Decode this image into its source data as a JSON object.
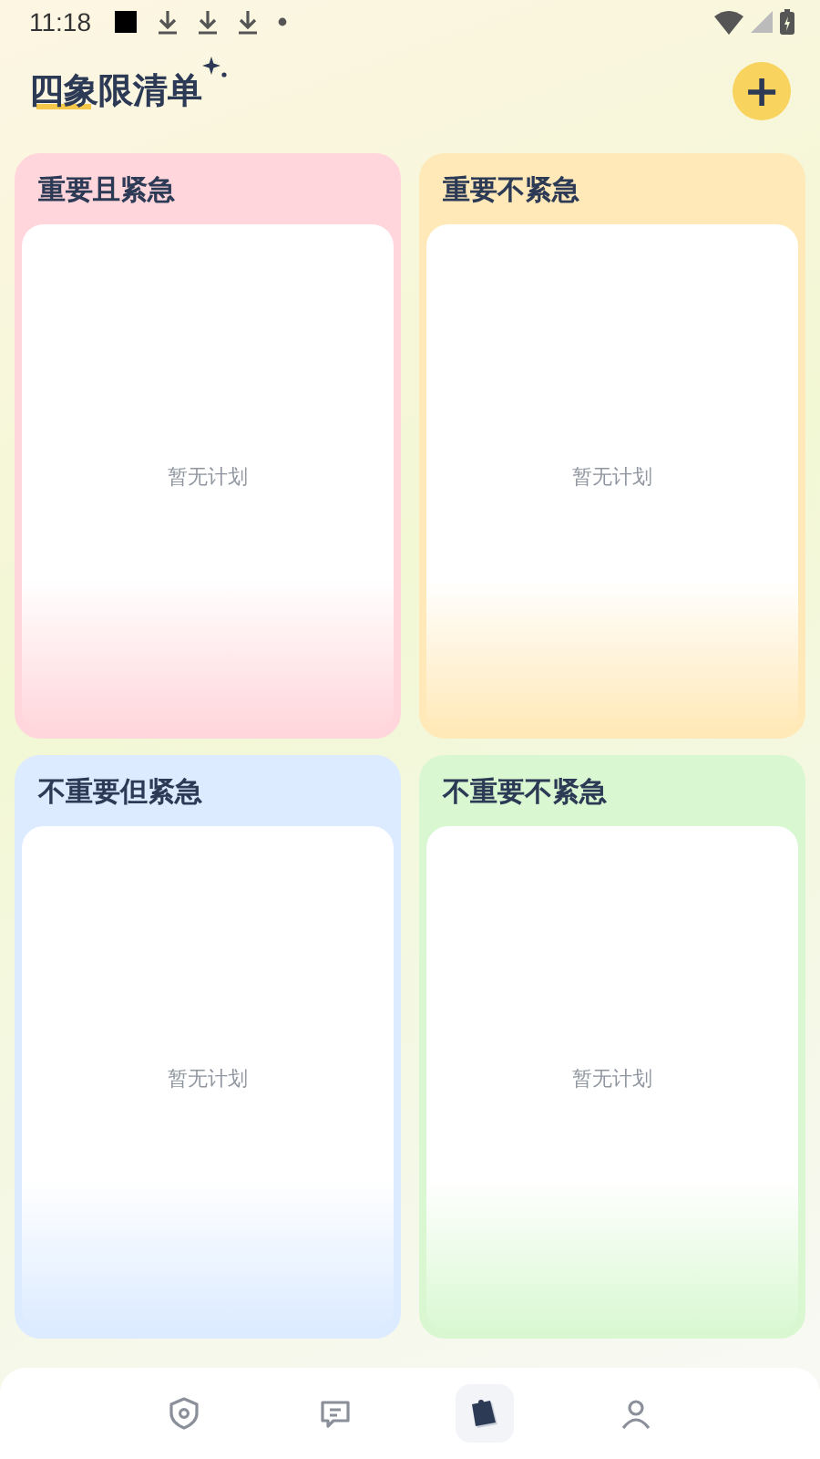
{
  "status_bar": {
    "time": "11:18"
  },
  "header": {
    "title": "四象限清单",
    "add_button": "+"
  },
  "quadrants": [
    {
      "title": "重要且紧急",
      "empty_text": "暂无计划",
      "color": "#ffd6db"
    },
    {
      "title": "重要不紧急",
      "empty_text": "暂无计划",
      "color": "#ffe9b8"
    },
    {
      "title": "不重要但紧急",
      "empty_text": "暂无计划",
      "color": "#dcebff"
    },
    {
      "title": "不重要不紧急",
      "empty_text": "暂无计划",
      "color": "#d9f8d2"
    }
  ],
  "bottom_nav": [
    {
      "kind": "shield",
      "selected": false
    },
    {
      "kind": "message",
      "selected": false
    },
    {
      "kind": "notes",
      "selected": true
    },
    {
      "kind": "person",
      "selected": false
    }
  ]
}
